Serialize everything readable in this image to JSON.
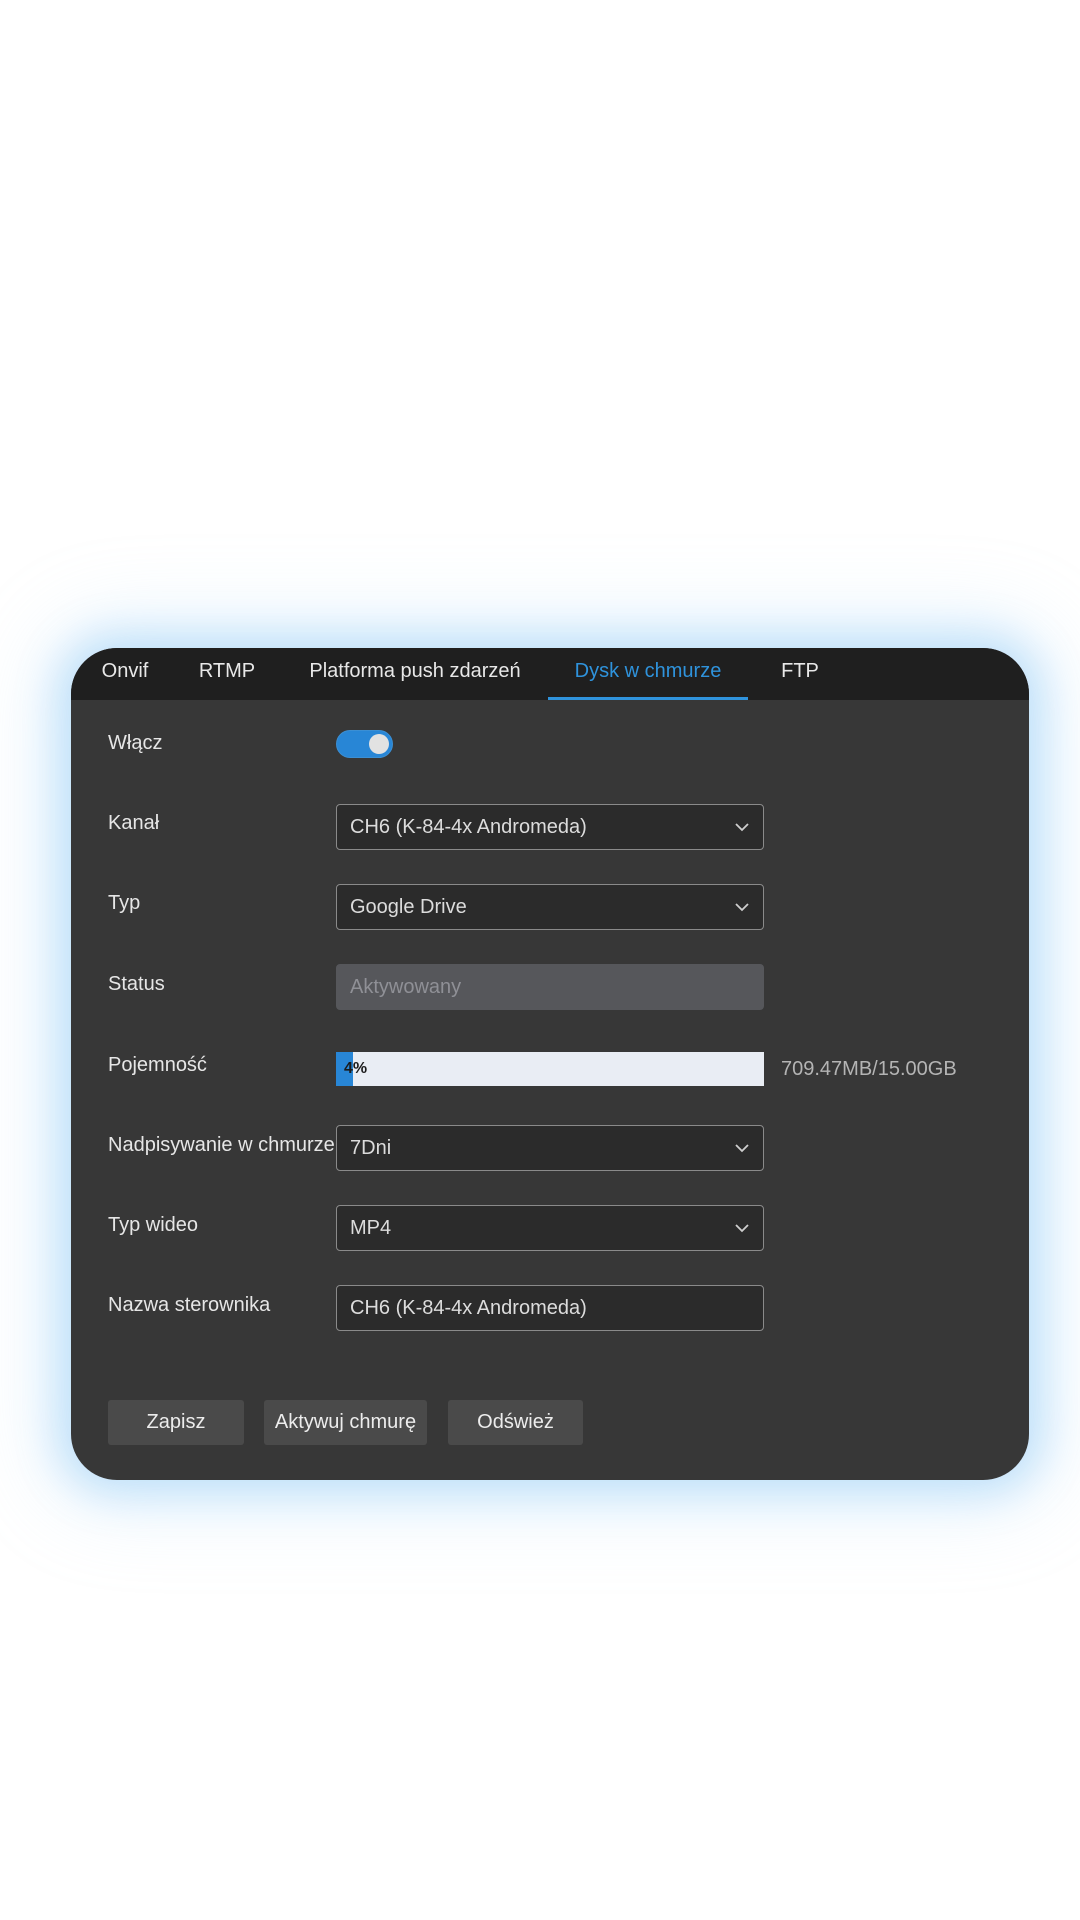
{
  "tabs": [
    "Onvif",
    "RTMP",
    "Platforma push zdarzeń",
    "Dysk w chmurze",
    "FTP"
  ],
  "active_tab": "Dysk w chmurze",
  "form": {
    "enable": {
      "label": "Włącz",
      "value": true
    },
    "channel": {
      "label": "Kanał",
      "value": "CH6 (K-84-4x Andromeda)"
    },
    "type": {
      "label": "Typ",
      "value": "Google Drive"
    },
    "status": {
      "label": "Status",
      "value": "Aktywowany"
    },
    "capacity": {
      "label": "Pojemność",
      "percent": 4,
      "percent_text": "4%",
      "usage_text": "709.47MB/15.00GB"
    },
    "overwrite": {
      "label": "Nadpisywanie w chmurze",
      "value": "7Dni"
    },
    "video_type": {
      "label": "Typ wideo",
      "value": "MP4"
    },
    "driver_name": {
      "label": "Nazwa sterownika",
      "value": "CH6 (K-84-4x Andromeda)"
    }
  },
  "buttons": {
    "save": "Zapisz",
    "activate_cloud": "Aktywuj chmurę",
    "refresh": "Odśwież"
  },
  "colors": {
    "accent": "#2886d6",
    "panel_bg": "#373737",
    "tabbar_bg": "#1f1f1f"
  }
}
